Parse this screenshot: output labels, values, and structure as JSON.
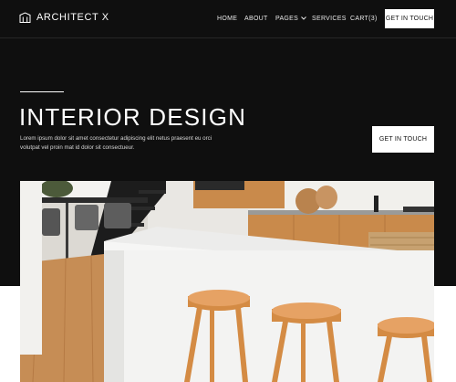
{
  "brand": {
    "name": "ARCHITECT X",
    "logo_icon": "building-outline-icon"
  },
  "nav": {
    "items": [
      {
        "label": "HOME"
      },
      {
        "label": "ABOUT"
      },
      {
        "label": "PAGES",
        "icon": "chevron-down-icon"
      },
      {
        "label": "SERVICES"
      },
      {
        "label": "CART(3)"
      }
    ],
    "cta_label": "GET IN TOUCH"
  },
  "hero": {
    "title": "INTERIOR DESIGN",
    "description": "Lorem ipsum dolor sit amet consectetur adipiscing elit netus praesent eu orci volutpat vel proin mat id dolor sit consectueur.",
    "cta_label": "GET IN TOUCH"
  },
  "colors": {
    "background_dark": "#0f0f0f",
    "button_bg": "#ffffff",
    "button_text": "#111111",
    "wood": "#c98a4b"
  }
}
